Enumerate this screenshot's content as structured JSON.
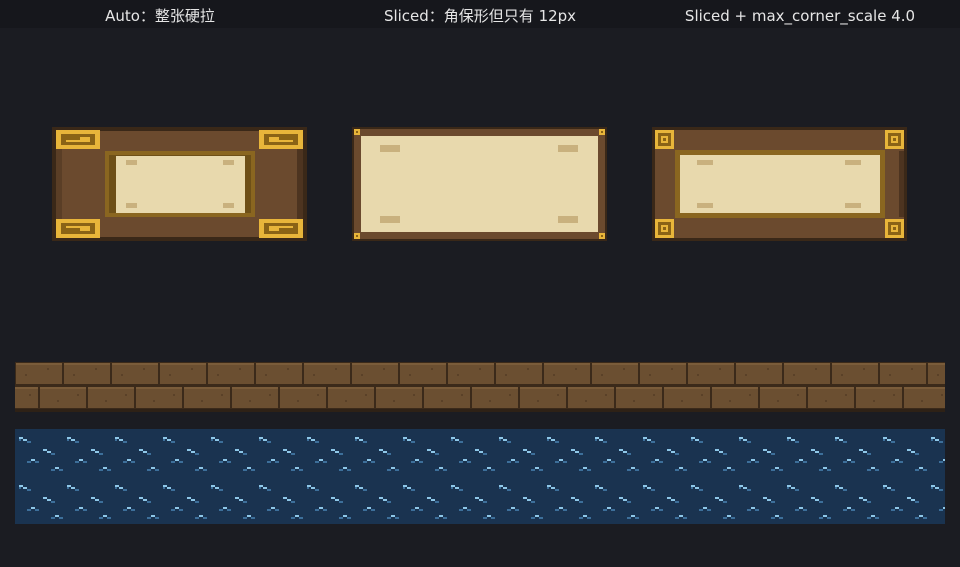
{
  "labels": {
    "auto": "Auto：整张硬拉",
    "sliced": "Sliced：角保形但只有 12px",
    "maxscale": "Sliced + max_corner_scale 4.0"
  },
  "colors": {
    "background": "#1b1c22",
    "topbar": "#16171c",
    "label_text": "#e6e6e6",
    "frame_outer": "#3a2818",
    "frame_wood": "#6b4a2e",
    "frame_wood_dark": "#4d3420",
    "gold": "#e8b53a",
    "gold_dark": "#8a6316",
    "inner_border": "#8a6620",
    "parchment": "#e8d9ad",
    "parchment_mark": "#c9b17e",
    "brick": "#6b4f31",
    "brick_mortar": "#3b2a1a",
    "water": "#1a3350",
    "wave_light": "#8ec7e8",
    "wave_dark": "#3d6f9a"
  },
  "icons": {
    "corner_ornament": "greek-key-corner-icon",
    "brick_tile": "brick-tile",
    "water_tile": "water-wave-tile"
  }
}
